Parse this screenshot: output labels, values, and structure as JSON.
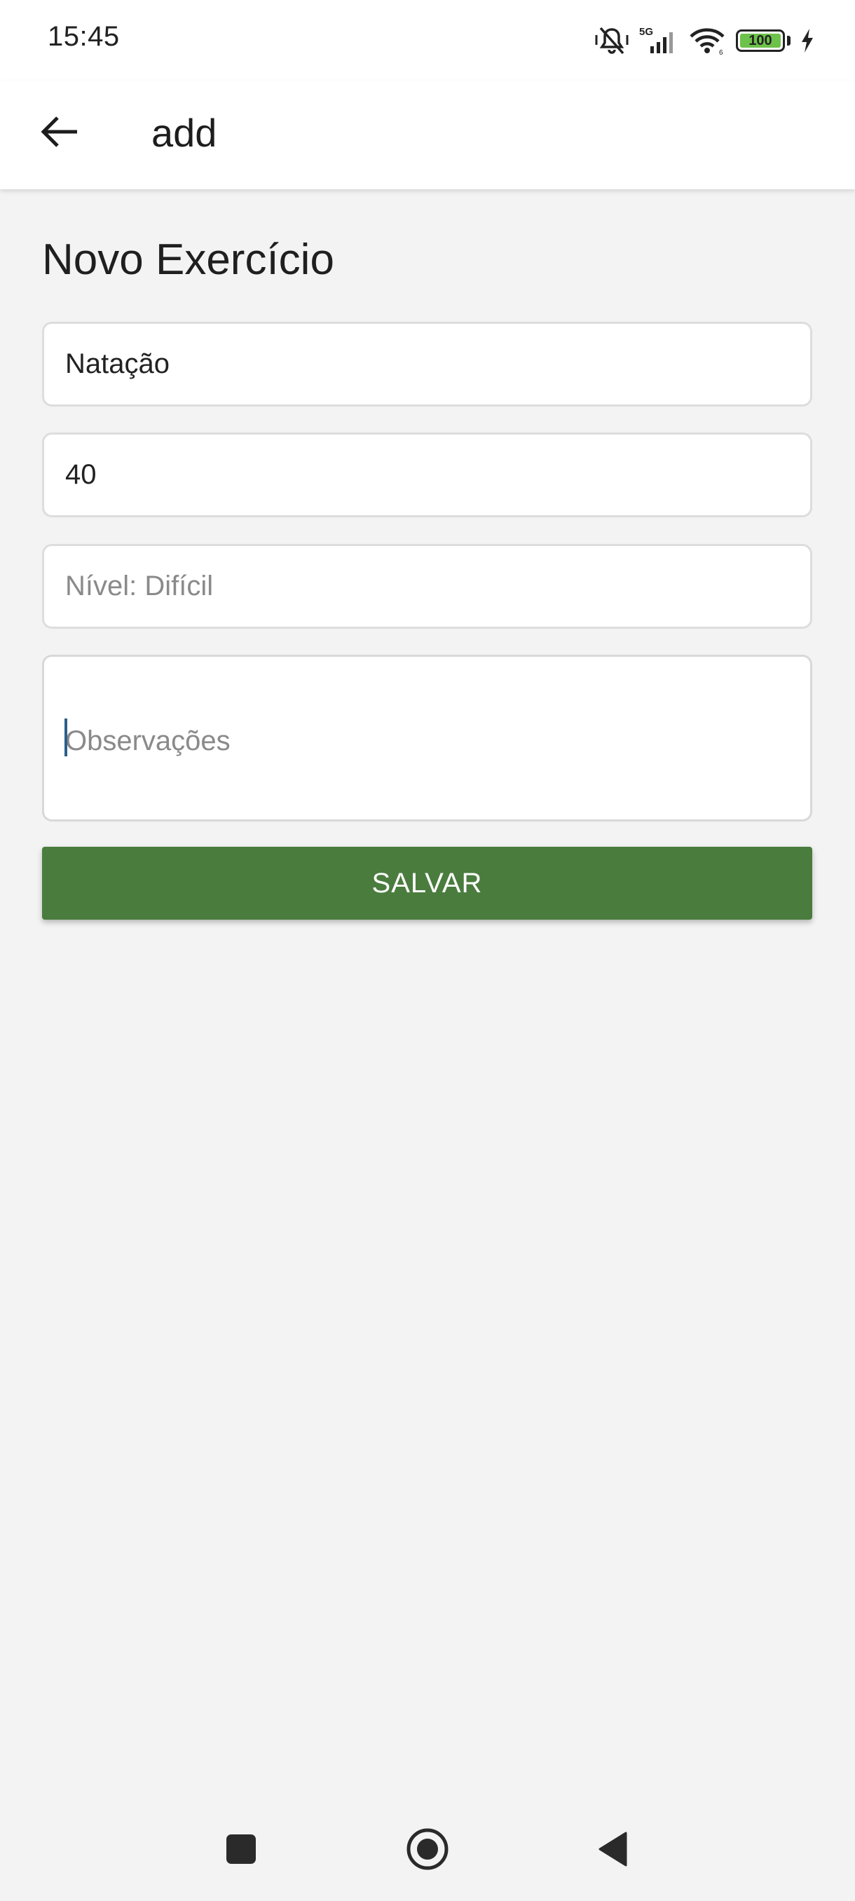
{
  "status_bar": {
    "time": "15:45",
    "network": "5G",
    "battery_level": "100",
    "icons": [
      "mute-vibrate-icon",
      "cellular-signal-icon",
      "wifi-icon",
      "battery-icon",
      "charging-bolt-icon"
    ],
    "battery_color": "#6cc24a"
  },
  "app_bar": {
    "back_icon": "arrow-left-icon",
    "title": "add"
  },
  "form": {
    "heading": "Novo Exercício",
    "name_value": "Natação",
    "duration_value": "40",
    "level_placeholder": "Nível: Difícil",
    "notes_placeholder": "Observações",
    "save_label": "SALVAR"
  },
  "nav_bar": {
    "icons": [
      "recents-square-icon",
      "home-circle-icon",
      "back-triangle-icon"
    ]
  },
  "colors": {
    "accent": "#4a7c3e",
    "background": "#f3f3f3",
    "surface": "#ffffff",
    "border": "#dddddd",
    "caret": "#2c5f8a"
  }
}
